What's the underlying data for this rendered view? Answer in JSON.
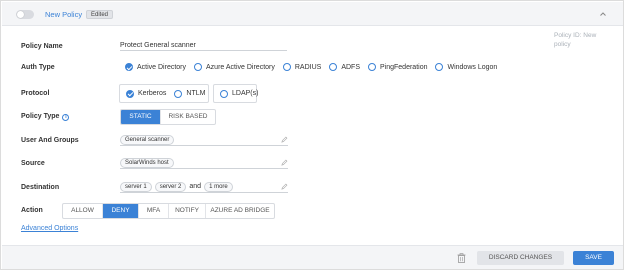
{
  "header": {
    "title": "New Policy",
    "badge": "Edited"
  },
  "policy_id": "Policy ID: New policy",
  "fields": {
    "policy_name": {
      "label": "Policy Name",
      "value": "Protect General scanner"
    },
    "auth_type": {
      "label": "Auth Type",
      "options": [
        {
          "label": "Active Directory",
          "checked": true
        },
        {
          "label": "Azure Active Directory",
          "checked": false
        },
        {
          "label": "RADIUS",
          "checked": false
        },
        {
          "label": "ADFS",
          "checked": false
        },
        {
          "label": "PingFederation",
          "checked": false
        },
        {
          "label": "Windows Logon",
          "checked": false
        }
      ]
    },
    "protocol": {
      "label": "Protocol",
      "options": [
        {
          "label": "Kerberos",
          "checked": true
        },
        {
          "label": "NTLM",
          "checked": false
        },
        {
          "label": "LDAP(s)",
          "checked": false
        }
      ]
    },
    "policy_type": {
      "label": "Policy Type",
      "info_icon": "info-icon",
      "options": [
        "STATIC",
        "RISK BASED"
      ],
      "selected": "STATIC"
    },
    "user_groups": {
      "label": "User And Groups",
      "chips": [
        "General scanner"
      ]
    },
    "source": {
      "label": "Source",
      "chips": [
        "SolarWinds host"
      ]
    },
    "destination": {
      "label": "Destination",
      "chips": [
        "server 1",
        "server 2"
      ],
      "joiner": "and",
      "more": "1 more"
    },
    "action": {
      "label": "Action",
      "options": [
        "ALLOW",
        "DENY",
        "MFA",
        "NOTIFY",
        "AZURE AD BRIDGE"
      ],
      "selected": "DENY"
    }
  },
  "advanced_link": "Advanced Options",
  "footer": {
    "discard": "DISCARD CHANGES",
    "save": "SAVE"
  },
  "colors": {
    "accent": "#3b82d6",
    "header_bg": "#f4f5f7"
  }
}
